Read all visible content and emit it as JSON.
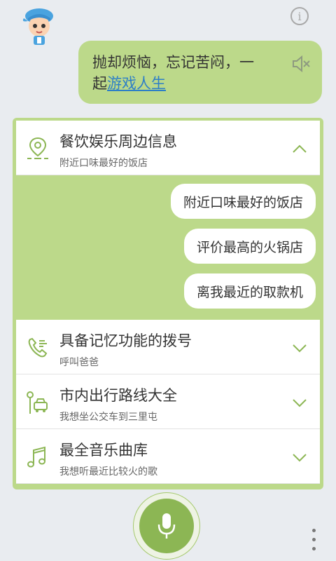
{
  "header": {
    "info_glyph": "i",
    "speech_line1": "抛却烦恼，忘记苦闷，一",
    "speech_line2_prefix": "起",
    "speech_link": "游戏人生"
  },
  "panel": {
    "expanded_section": {
      "title": "餐饮娱乐周边信息",
      "subtitle": "附近口味最好的饭店",
      "suggestions": [
        "附近口味最好的饭店",
        "评价最高的火锅店",
        "离我最近的取款机"
      ]
    },
    "sections": [
      {
        "title": "具备记忆功能的拨号",
        "subtitle": "呼叫爸爸",
        "icon": "phone-icon"
      },
      {
        "title": "市内出行路线大全",
        "subtitle": "我想坐公交车到三里屯",
        "icon": "route-icon"
      },
      {
        "title": "最全音乐曲库",
        "subtitle": "我想听最近比较火的歌",
        "icon": "music-icon"
      }
    ]
  },
  "colors": {
    "accent_green": "#bcd98a",
    "mic_green": "#8cb654",
    "icon_green": "#8cb654",
    "link_blue": "#2d7fc7"
  }
}
